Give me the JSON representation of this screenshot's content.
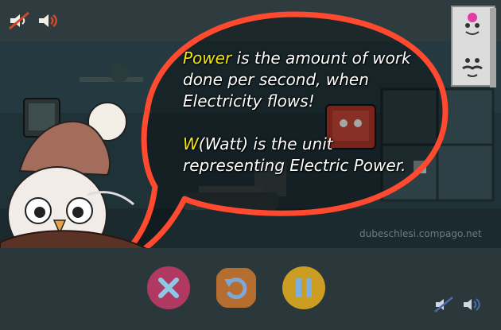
{
  "dialogue": {
    "paragraph1": {
      "keyword": "Power",
      "text": " is the amount of work done per second, when Electricity flows!"
    },
    "paragraph2": {
      "keyword": "W",
      "text": "(Watt) is the unit representing Electric Power."
    }
  },
  "watermark": "dubeschlesi.compago.net",
  "icons": {
    "top_left": [
      "sound-off-icon",
      "sound-on-icon"
    ],
    "top_right_card": [
      "happy-face-icon",
      "mustache-face-icon"
    ],
    "bottom_controls": [
      "close-icon",
      "restart-icon",
      "pause-icon"
    ],
    "bottom_right": [
      "sound-off-icon",
      "sound-on-icon"
    ]
  },
  "colors": {
    "bubble_outline": "#ff4a30",
    "keyword": "#f5e800",
    "close_button": "#c83a6a",
    "restart_button": "#d87a2e",
    "pause_button": "#e8b020"
  }
}
